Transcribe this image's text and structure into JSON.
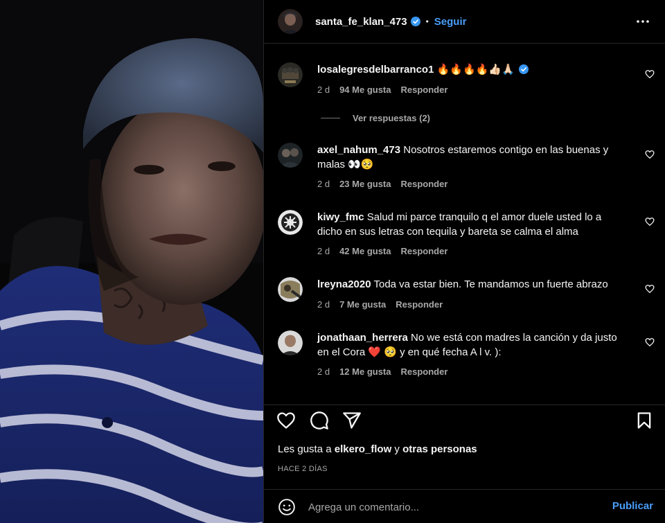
{
  "post": {
    "author": "santa_fe_klan_473",
    "follow_label": "Seguir",
    "dot": "•"
  },
  "comments": [
    {
      "username": "losalegresdelbarranco1",
      "text": " 🔥🔥🔥🔥👍🏻🙏🏻",
      "age": "2 d",
      "likes": "94 Me gusta",
      "reply": "Responder",
      "view_replies": "Ver respuestas (2)"
    },
    {
      "username": "axel_nahum_473",
      "text": " Nosotros estaremos contigo en las buenas y malas 👀🥺",
      "age": "2 d",
      "likes": "23 Me gusta",
      "reply": "Responder"
    },
    {
      "username": "kiwy_fmc",
      "text": " Salud mi parce tranquilo q el amor duele usted lo a dicho en sus letras con tequila y bareta se calma el alma",
      "age": "2 d",
      "likes": "42 Me gusta",
      "reply": "Responder"
    },
    {
      "username": "lreyna2020",
      "text": " Toda va estar bien. Te mandamos un fuerte abrazo",
      "age": "2 d",
      "likes": "7 Me gusta",
      "reply": "Responder"
    },
    {
      "username": "jonathaan_herrera",
      "text": " No we está con madres la canción y da justo en el Cora ❤️ 🥺 y en qué fecha A l v. ):",
      "age": "2 d",
      "likes": "12 Me gusta",
      "reply": "Responder"
    }
  ],
  "likes_line": {
    "prefix": "Les gusta a ",
    "user": "elkero_flow",
    "mid": " y ",
    "others": "otras personas"
  },
  "time_ago": "HACE 2 DÍAS",
  "add_comment": {
    "placeholder": "Agrega un comentario...",
    "publish_label": "Publicar"
  },
  "colors": {
    "accent": "#4a9df8",
    "verified": "#3897f0",
    "secondary_text": "#a8a8a8"
  },
  "icons": [
    "more-options-icon",
    "verified-icon",
    "heart-icon",
    "comment-icon",
    "share-icon",
    "bookmark-icon",
    "emoji-icon"
  ]
}
